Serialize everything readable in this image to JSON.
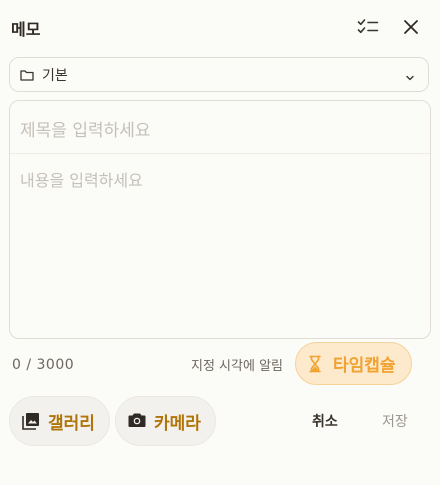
{
  "header": {
    "title": "메모",
    "checklist_icon": "checklist-icon",
    "close_icon": "close-icon"
  },
  "folder": {
    "label": "기본",
    "icon": "folder-icon",
    "chevron": "chevron-down-icon"
  },
  "editor": {
    "title_placeholder": "제목을 입력하세요",
    "body_placeholder": "내용을 입력하세요"
  },
  "footer": {
    "counter": "0 / 3000",
    "remind_text": "지정 시각에 알림",
    "time_capsule_label": "타임캡슐",
    "gallery_label": "갤러리",
    "camera_label": "카메라",
    "cancel_label": "취소",
    "save_label": "저장"
  },
  "colors": {
    "accent": "#f0a331",
    "accent_bg": "#fde9cc",
    "pill_text": "#b07508",
    "background": "#fbfbf8"
  }
}
